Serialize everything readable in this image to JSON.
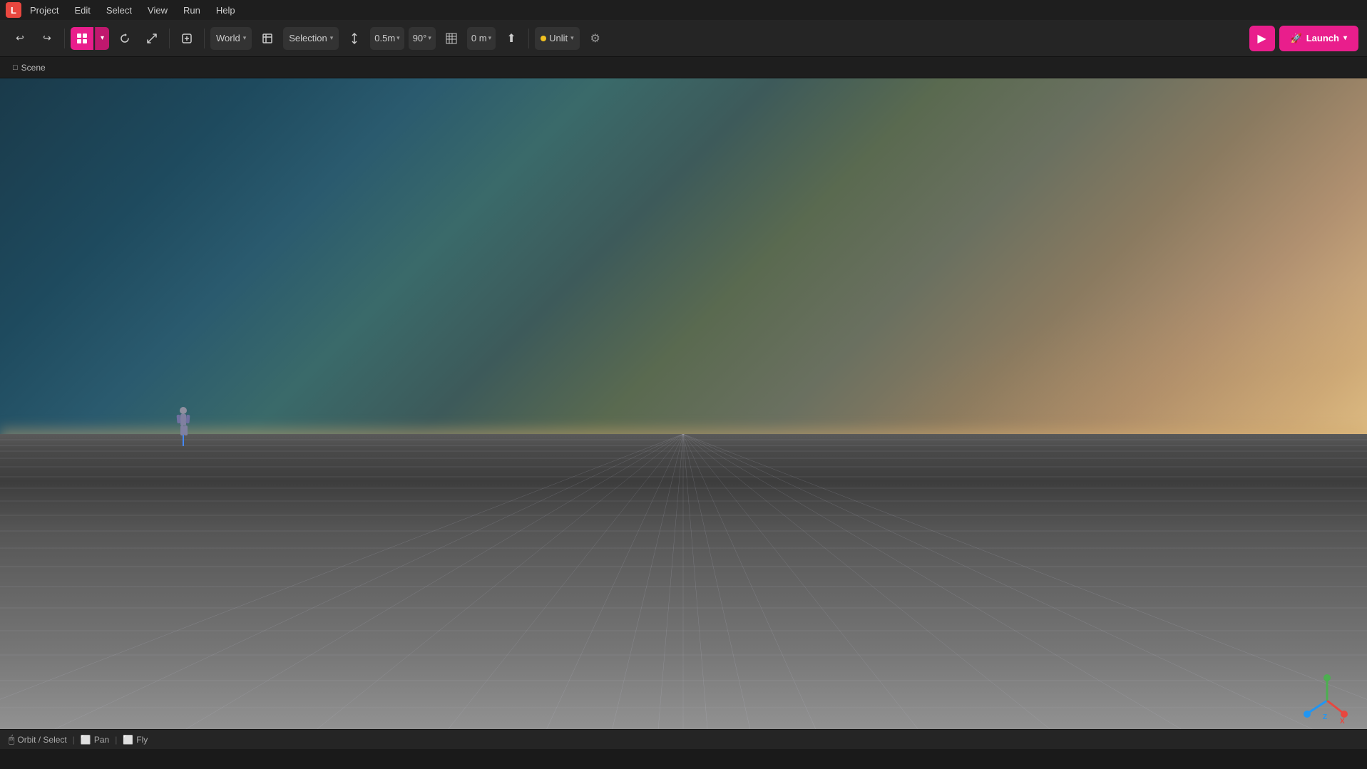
{
  "app": {
    "logo": "L",
    "logo_color": "#e8473f"
  },
  "menubar": {
    "items": [
      "Project",
      "Edit",
      "Select",
      "View",
      "Run",
      "Help"
    ]
  },
  "toolbar": {
    "undo_label": "↩",
    "redo_label": "↪",
    "world_label": "World",
    "selection_label": "Selection",
    "snap_distance": "0.5m",
    "snap_angle": "90°",
    "grid_icon": "⊞",
    "distance_label": "0 m",
    "transform_icon": "⤢",
    "unlit_label": "Unlit",
    "settings_icon": "⚙",
    "play_icon": "▶",
    "launch_icon": "🚀",
    "launch_label": "Launch"
  },
  "scene_tab": {
    "label": "Scene"
  },
  "statusbar": {
    "orbit_label": "Orbit / Select",
    "pan_label": "Pan",
    "fly_label": "Fly"
  },
  "gizmo": {
    "x_color": "#e8473f",
    "y_color": "#4caf50",
    "z_color": "#2196f3"
  }
}
